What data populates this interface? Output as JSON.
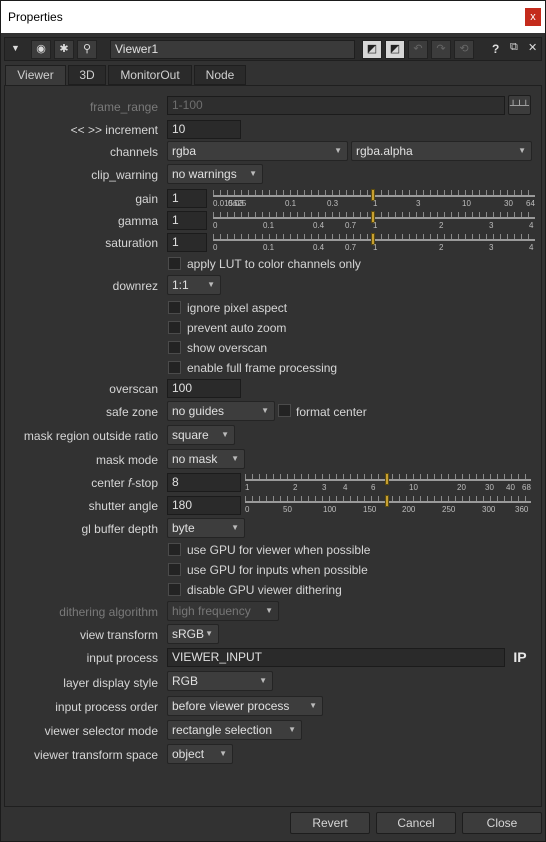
{
  "window": {
    "title": "Properties",
    "close_glyph": "x"
  },
  "toolbar": {
    "node_name": "Viewer1",
    "help_glyph": "?",
    "icons": [
      "collapse-triangle-icon",
      "target-icon",
      "node-graph-icon",
      "wrench-icon",
      "input-a-icon",
      "input-b-icon",
      "undo-icon",
      "redo-icon",
      "revert-icon",
      "help-icon",
      "float-icon",
      "close-panel-icon"
    ]
  },
  "tabs": [
    {
      "label": "Viewer",
      "active": true
    },
    {
      "label": "3D",
      "active": false
    },
    {
      "label": "MonitorOut",
      "active": false
    },
    {
      "label": "Node",
      "active": false
    }
  ],
  "knobs": {
    "frame_range": {
      "label": "frame_range",
      "value": "1-100"
    },
    "increment": {
      "label": "<< >> increment",
      "value": "10"
    },
    "channels": {
      "label": "channels",
      "value": "rgba",
      "value2": "rgba.alpha"
    },
    "clip_warning": {
      "label": "clip_warning",
      "value": "no warnings"
    },
    "gain": {
      "label": "gain",
      "value": "1",
      "ticks": [
        "0.015625",
        "0.03",
        "0.1",
        "0.3",
        "1",
        "3",
        "10",
        "30",
        "64"
      ]
    },
    "gamma": {
      "label": "gamma",
      "value": "1",
      "ticks": [
        "0",
        "0.1",
        "0.4",
        "0.7",
        "1",
        "2",
        "3",
        "4"
      ]
    },
    "saturation": {
      "label": "saturation",
      "value": "1",
      "ticks": [
        "0",
        "0.1",
        "0.4",
        "0.7",
        "1",
        "2",
        "3",
        "4"
      ]
    },
    "apply_lut": {
      "label": "apply LUT to color channels only",
      "checked": false
    },
    "downrez": {
      "label": "downrez",
      "value": "1:1"
    },
    "ignore_pixel_aspect": {
      "label": "ignore pixel aspect",
      "checked": false
    },
    "prevent_auto_zoom": {
      "label": "prevent auto zoom",
      "checked": false
    },
    "show_overscan": {
      "label": "show overscan",
      "checked": false
    },
    "full_frame": {
      "label": "enable full frame processing",
      "checked": false
    },
    "overscan": {
      "label": "overscan",
      "value": "100"
    },
    "safe_zone": {
      "label": "safe zone",
      "value": "no guides",
      "format_center": "format center"
    },
    "mask_region": {
      "label": "mask region outside ratio",
      "value": "square"
    },
    "mask_mode": {
      "label": "mask mode",
      "value": "no mask"
    },
    "center_fstop": {
      "label_pre": "center ",
      "label_f": "f",
      "label_post": "-stop",
      "value": "8",
      "ticks": [
        "1",
        "2",
        "3",
        "4",
        "6",
        "10",
        "20",
        "30",
        "40",
        "68"
      ]
    },
    "shutter_angle": {
      "label": "shutter angle",
      "value": "180",
      "ticks": [
        "0",
        "50",
        "100",
        "150",
        "200",
        "250",
        "300",
        "360"
      ]
    },
    "gl_buffer_depth": {
      "label": "gl buffer depth",
      "value": "byte"
    },
    "gpu_viewer": {
      "label": "use GPU for viewer when possible",
      "checked": false
    },
    "gpu_inputs": {
      "label": "use GPU for inputs when possible",
      "checked": false
    },
    "gpu_dither": {
      "label": "disable GPU viewer dithering",
      "checked": false
    },
    "dithering_algorithm": {
      "label": "dithering algorithm",
      "value": "high frequency"
    },
    "view_transform": {
      "label": "view transform",
      "value": "sRGB"
    },
    "input_process": {
      "label": "input process",
      "value": "VIEWER_INPUT",
      "ip_badge": "IP"
    },
    "layer_display_style": {
      "label": "layer display style",
      "value": "RGB"
    },
    "input_process_order": {
      "label": "input process order",
      "value": "before viewer process"
    },
    "viewer_selector_mode": {
      "label": "viewer selector mode",
      "value": "rectangle selection"
    },
    "viewer_transform_space": {
      "label": "viewer transform space",
      "value": "object"
    }
  },
  "footer": {
    "revert": "Revert",
    "cancel": "Cancel",
    "close": "Close"
  }
}
